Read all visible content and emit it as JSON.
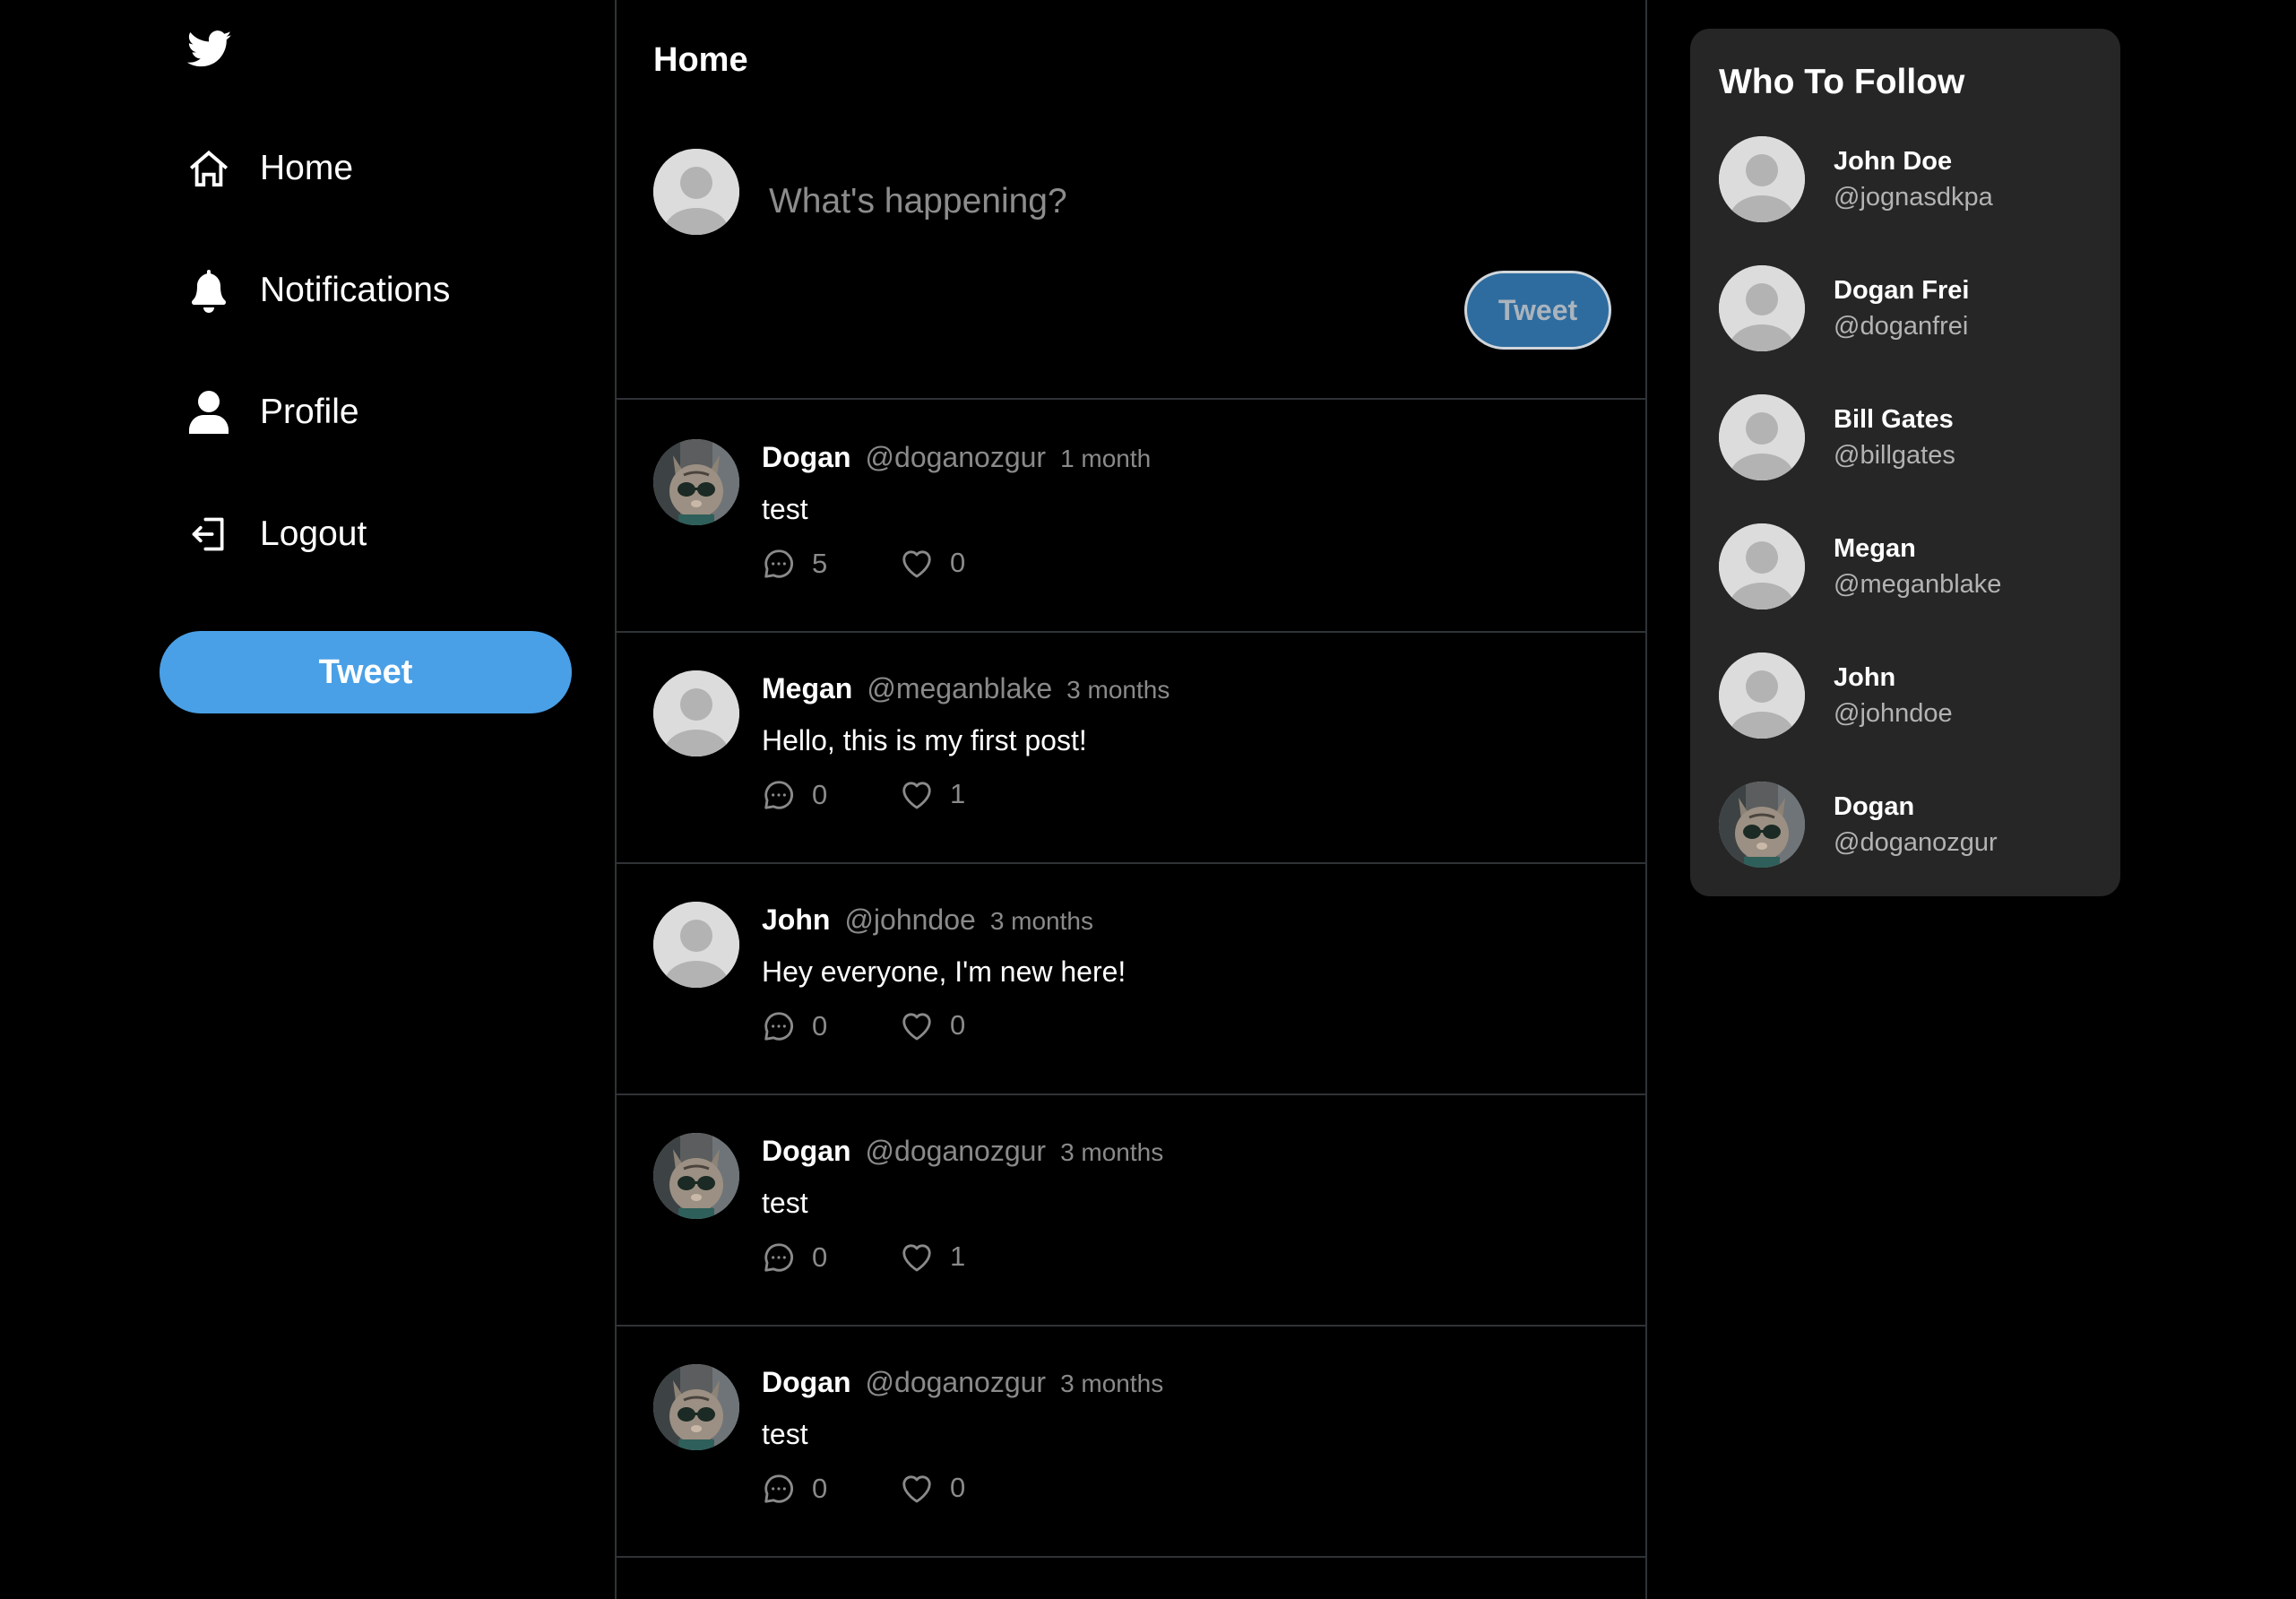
{
  "app": {
    "brand_icon": "twitter-bird-icon"
  },
  "sidebar": {
    "items": [
      {
        "label": "Home",
        "icon": "home-icon"
      },
      {
        "label": "Notifications",
        "icon": "bell-icon"
      },
      {
        "label": "Profile",
        "icon": "user-icon"
      },
      {
        "label": "Logout",
        "icon": "logout-icon"
      }
    ],
    "tweet_button": "Tweet"
  },
  "main": {
    "title": "Home",
    "composer": {
      "placeholder": "What's happening?",
      "button": "Tweet"
    },
    "tweets": [
      {
        "name": "Dogan",
        "handle": "@doganozgur",
        "time": "1 month",
        "text": "test",
        "replies": "5",
        "likes": "0",
        "avatar": "cat-photo"
      },
      {
        "name": "Megan",
        "handle": "@meganblake",
        "time": "3 months",
        "text": "Hello, this is my first post!",
        "replies": "0",
        "likes": "1",
        "avatar": "default"
      },
      {
        "name": "John",
        "handle": "@johndoe",
        "time": "3 months",
        "text": "Hey everyone, I'm new here!",
        "replies": "0",
        "likes": "0",
        "avatar": "default"
      },
      {
        "name": "Dogan",
        "handle": "@doganozgur",
        "time": "3 months",
        "text": "test",
        "replies": "0",
        "likes": "1",
        "avatar": "cat-photo"
      },
      {
        "name": "Dogan",
        "handle": "@doganozgur",
        "time": "3 months",
        "text": "test",
        "replies": "0",
        "likes": "0",
        "avatar": "cat-photo"
      }
    ]
  },
  "who_to_follow": {
    "title": "Who To Follow",
    "users": [
      {
        "name": "John Doe",
        "handle": "@jognasdkpa",
        "avatar": "default"
      },
      {
        "name": "Dogan Frei",
        "handle": "@doganfrei",
        "avatar": "default"
      },
      {
        "name": "Bill Gates",
        "handle": "@billgates",
        "avatar": "default"
      },
      {
        "name": "Megan",
        "handle": "@meganblake",
        "avatar": "default"
      },
      {
        "name": "John",
        "handle": "@johndoe",
        "avatar": "default"
      },
      {
        "name": "Dogan",
        "handle": "@doganozgur",
        "avatar": "cat-photo"
      }
    ]
  },
  "colors": {
    "background": "#000000",
    "accent": "#4aa0e6",
    "panel": "#262626",
    "muted_text": "#8a8a8a",
    "divider": "#2f3336"
  }
}
